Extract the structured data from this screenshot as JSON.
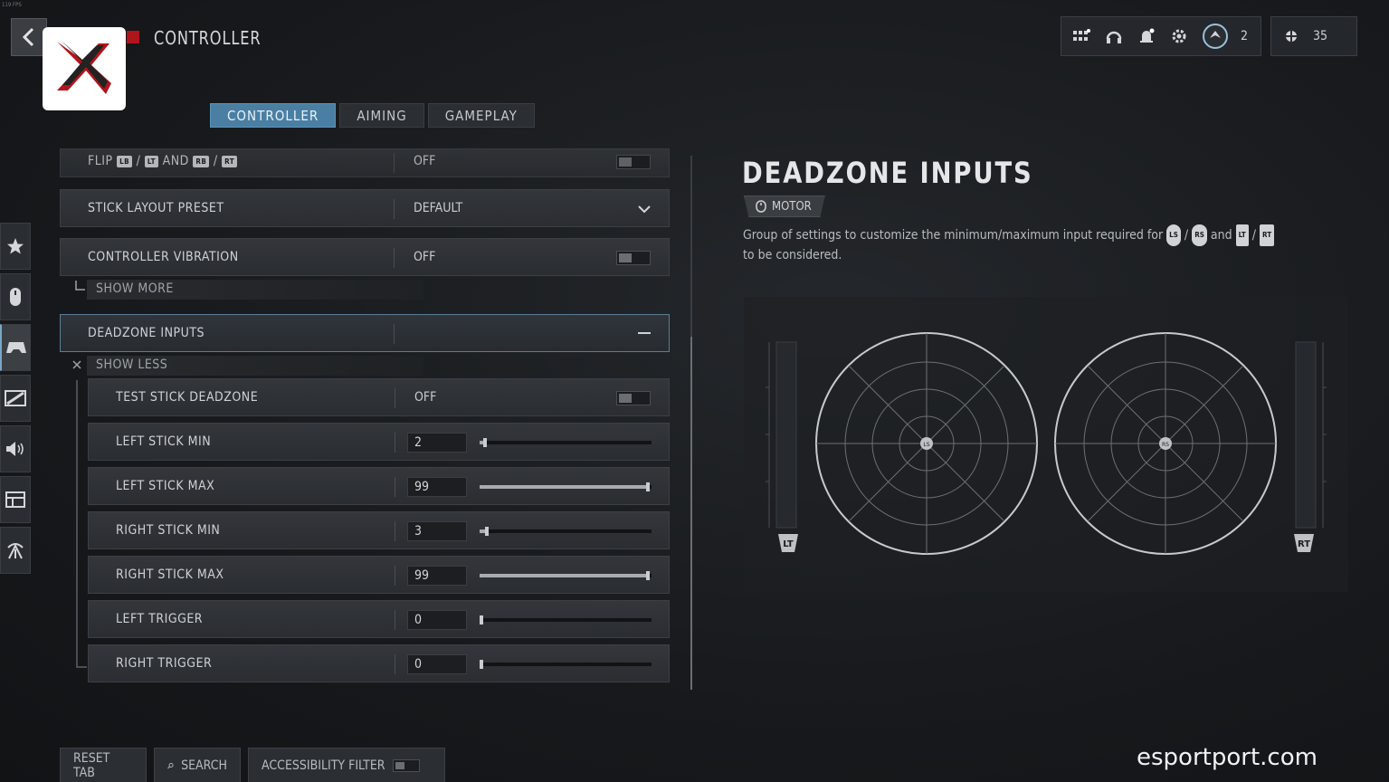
{
  "fps_label": "119 FPS",
  "header": {
    "title": "CONTROLLER",
    "level_badge": "2",
    "currency": "35",
    "icons": [
      "grid-apps-icon",
      "headset-icon",
      "bell-icon",
      "gear-icon",
      "rank-emblem-icon",
      "currency-icon"
    ]
  },
  "tabs": [
    {
      "label": "CONTROLLER",
      "active": true
    },
    {
      "label": "AIMING",
      "active": false
    },
    {
      "label": "GAMEPLAY",
      "active": false
    }
  ],
  "rail": [
    "star-icon",
    "mouse-icon",
    "gamepad-icon",
    "display-icon",
    "speaker-icon",
    "interface-icon",
    "network-icon"
  ],
  "settings": {
    "flip": {
      "label_a": "FLIP",
      "btn1": "LB",
      "slash1": "/",
      "btn2": "LT",
      "and": "AND",
      "btn3": "RB",
      "slash2": "/",
      "btn4": "RT",
      "value": "OFF"
    },
    "stick_layout": {
      "label": "STICK LAYOUT PRESET",
      "value": "DEFAULT"
    },
    "vibration": {
      "label": "CONTROLLER VIBRATION",
      "value": "OFF"
    },
    "show_more": "SHOW MORE",
    "deadzone_group": {
      "label": "DEADZONE INPUTS"
    },
    "show_less": "SHOW LESS",
    "test_stick": {
      "label": "TEST STICK DEADZONE",
      "value": "OFF"
    },
    "sliders": [
      {
        "label": "LEFT STICK MIN",
        "value": "2",
        "level": 0.02
      },
      {
        "label": "LEFT STICK MAX",
        "value": "99",
        "level": 0.99
      },
      {
        "label": "RIGHT STICK MIN",
        "value": "3",
        "level": 0.03
      },
      {
        "label": "RIGHT STICK MAX",
        "value": "99",
        "level": 0.99
      },
      {
        "label": "LEFT TRIGGER",
        "value": "0",
        "level": 0
      },
      {
        "label": "RIGHT TRIGGER",
        "value": "0",
        "level": 0
      }
    ]
  },
  "panel": {
    "title": "DEADZONE INPUTS",
    "tag": "MOTOR",
    "desc_1": "Group of settings to customize the minimum/maximum input required for ",
    "ls": "LS",
    "sep": " / ",
    "rs": "RS",
    "and": " and ",
    "lt": "LT",
    "rt": "RT",
    "desc_2": " to be considered.",
    "left_trigger_label": "LT",
    "right_trigger_label": "RT",
    "left_stick_label": "LS",
    "right_stick_label": "RS"
  },
  "bottom": {
    "reset": "RESET TAB",
    "search": "SEARCH",
    "accessibility": "ACCESSIBILITY FILTER"
  },
  "watermark": "esportport.com"
}
